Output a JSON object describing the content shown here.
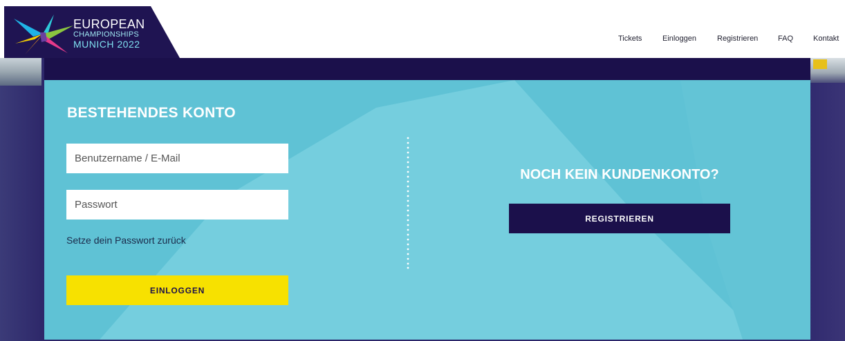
{
  "header": {
    "logo": {
      "line1": "EUROPEAN",
      "line2": "CHAMPIONSHIPS",
      "line3": "MUNICH 2022"
    },
    "nav": [
      {
        "label": "Tickets"
      },
      {
        "label": "Einloggen"
      },
      {
        "label": "Registrieren"
      },
      {
        "label": "FAQ"
      },
      {
        "label": "Kontakt"
      }
    ]
  },
  "login": {
    "heading": "BESTEHENDES KONTO",
    "username_placeholder": "Benutzername / E-Mail",
    "password_placeholder": "Passwort",
    "reset_link": "Setze dein Passwort zurück",
    "login_button": "EINLOGGEN"
  },
  "register": {
    "heading": "NOCH KEIN KUNDENKONTO?",
    "register_button": "REGISTRIEREN"
  },
  "colors": {
    "navy": "#1b104b",
    "panel": "#5fc2d5",
    "accent_yellow": "#f7e100"
  }
}
